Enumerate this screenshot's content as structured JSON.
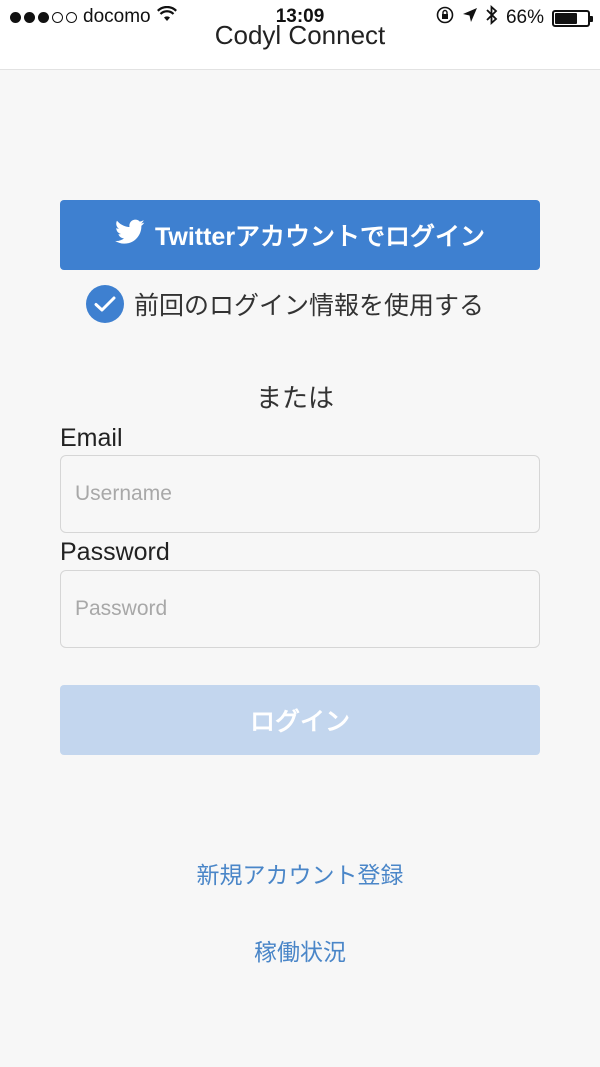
{
  "status_bar": {
    "carrier": "docomo",
    "time": "13:09",
    "battery": "66%",
    "signal_bars_filled": 3,
    "signal_bars_total": 5
  },
  "nav": {
    "title": "Codyl Connect"
  },
  "twitter_login": {
    "label": "Twitterアカウントでログイン"
  },
  "remember": {
    "label": "前回のログイン情報を使用する",
    "checked": true
  },
  "separator": {
    "text": "または"
  },
  "form": {
    "email_label": "Email",
    "email_placeholder": "Username",
    "email_value": "",
    "password_label": "Password",
    "password_placeholder": "Password",
    "password_value": ""
  },
  "login_button": {
    "label": "ログイン"
  },
  "links": {
    "register": "新規アカウント登録",
    "status": "稼働状況"
  },
  "colors": {
    "accent": "#3e80d0",
    "login_disabled": "#c3d6ee",
    "link": "#4a86c8",
    "background": "#f7f7f7"
  }
}
